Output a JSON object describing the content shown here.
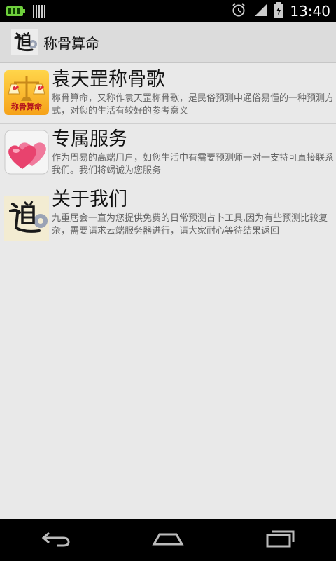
{
  "status_bar": {
    "time": "13:40",
    "icons": [
      "battery-charging-icon",
      "barcode-icon",
      "alarm-icon",
      "signal-icon",
      "battery-icon"
    ]
  },
  "action_bar": {
    "title": "称骨算命",
    "icon": "dao-logo-icon"
  },
  "list": {
    "items": [
      {
        "title": "袁天罡称骨歌",
        "description": "称骨算命，又称作袁天罡称骨歌，是民俗预测中通俗易懂的一种预测方式，对您的生活有较好的参考意义",
        "icon": "scale-hearts-icon",
        "icon_text": "称骨算命"
      },
      {
        "title": "专属服务",
        "description": "作为周易的高端用户，如您生活中有需要预测师一对一支持可直接联系我们。我们将竭诚为您服务",
        "icon": "double-heart-icon"
      },
      {
        "title": "关于我们",
        "description": "九重居会一直为您提供免费的日常预测占卜工具,因为有些预测比较复杂，需要请求云端服务器进行，请大家耐心等待结果返回",
        "icon": "dao-logo-icon"
      }
    ]
  },
  "nav_bar": {
    "buttons": [
      "back-icon",
      "home-icon",
      "recent-apps-icon"
    ]
  }
}
